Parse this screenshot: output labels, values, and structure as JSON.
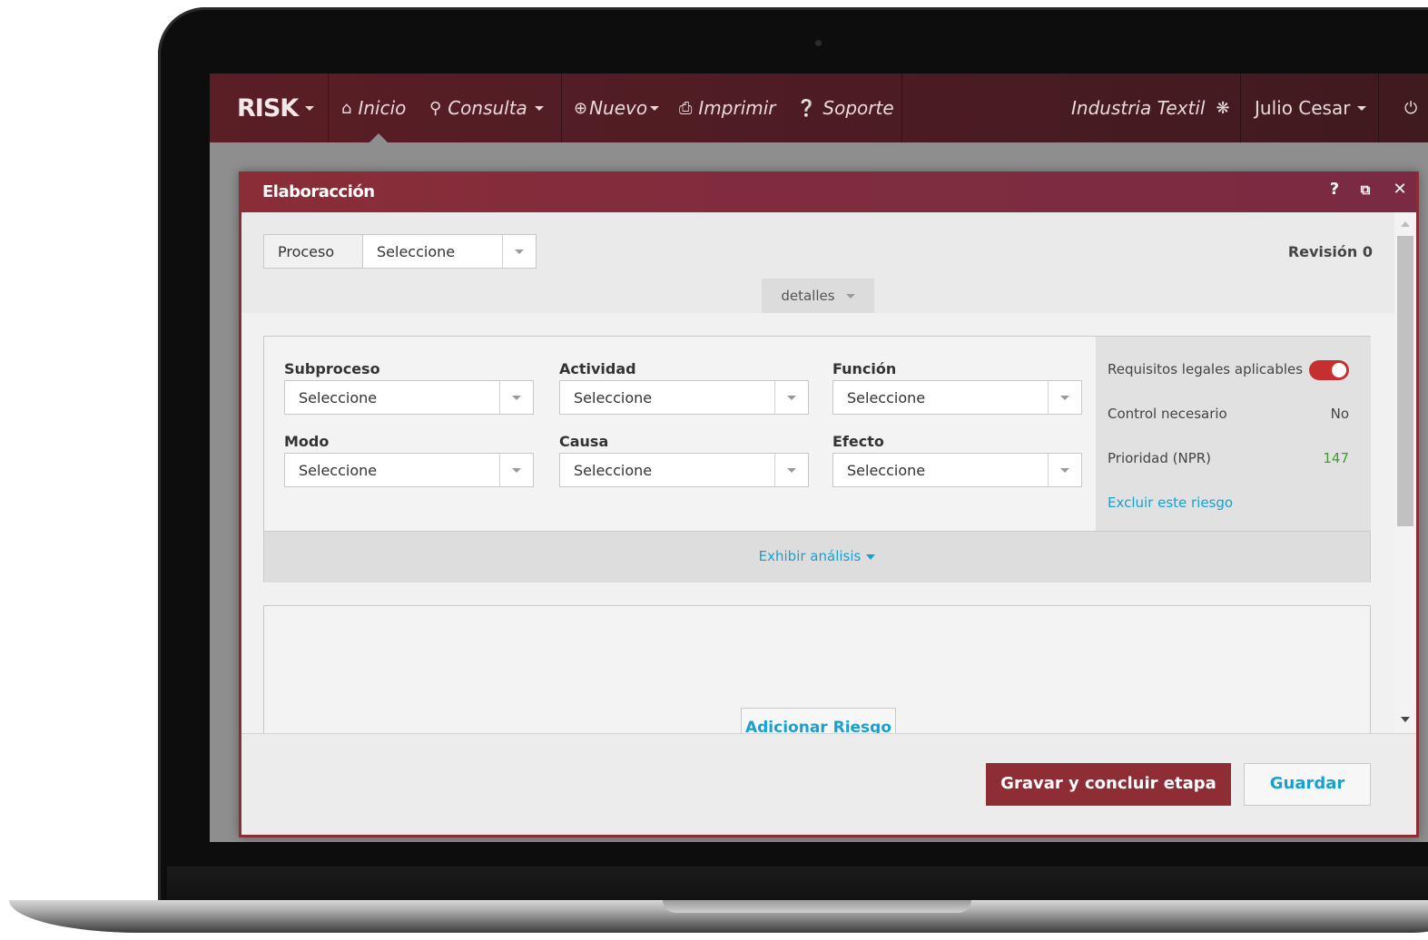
{
  "navbar": {
    "brand": "RISK",
    "items": [
      {
        "label": "Inicio",
        "icon": "home-icon"
      },
      {
        "label": "Consulta",
        "icon": "search-icon"
      },
      {
        "label": "Nuevo",
        "icon": "plus-circle-icon"
      },
      {
        "label": "Imprimir",
        "icon": "printer-icon"
      },
      {
        "label": "Soporte",
        "icon": "help-circle-icon"
      }
    ],
    "company": "Industria Textil",
    "user": "Julio Cesar"
  },
  "modal": {
    "title": "Elaboracción",
    "help": "?",
    "revision": "Revisión 0",
    "proceso_label": "Proceso",
    "proceso_value": "Seleccione",
    "details_tab": "detalles",
    "fields": [
      {
        "label": "Subproceso",
        "value": "Seleccione"
      },
      {
        "label": "Actividad",
        "value": "Seleccione"
      },
      {
        "label": "Función",
        "value": "Seleccione"
      },
      {
        "label": "Modo",
        "value": "Seleccione"
      },
      {
        "label": "Causa",
        "value": "Seleccione"
      },
      {
        "label": "Efecto",
        "value": "Seleccione"
      }
    ],
    "side": {
      "legal_label": "Requisitos legales aplicables",
      "legal_on": true,
      "control_label": "Control necesario",
      "control_value": "No",
      "priority_label": "Prioridad (NPR)",
      "priority_value": "147",
      "exclude_link": "Excluir este riesgo"
    },
    "analysis_link": "Exhibir análisis",
    "add_risk": "Adicionar Riesgo",
    "save_conclude": "Gravar y concluir etapa",
    "save": "Guardar"
  },
  "colors": {
    "navbar": "#4f1d23",
    "modal_header": "#862d3a",
    "primary_button": "#8f2d34",
    "link": "#1a9fd1",
    "toggle": "#c62f2f",
    "priority": "#3f9e2e"
  }
}
